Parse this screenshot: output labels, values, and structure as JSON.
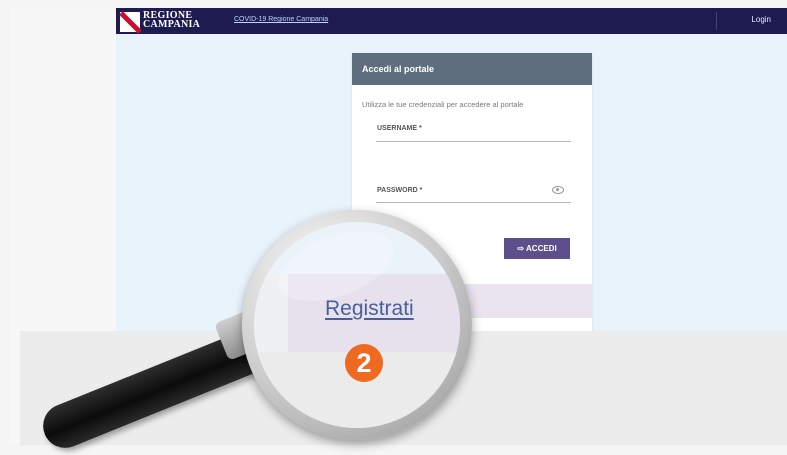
{
  "header": {
    "brand_line1": "REGIONE",
    "brand_line2": "CAMPANIA",
    "covid_link": "COVID-19 Regione Campania",
    "login": "Login"
  },
  "login_card": {
    "title": "Accedi al portale",
    "description": "Utilizza le tue credenziali per accedere al portale",
    "username_label": "USERNAME *",
    "password_label": "PASSWORD *",
    "submit_label": "ACCEDI"
  },
  "magnifier": {
    "register_link": "Registrati",
    "step_number": "2"
  },
  "colors": {
    "topbar": "#1d1b4f",
    "card_header": "#5e6e7e",
    "button": "#5c4f8c",
    "badge": "#ee6a20"
  }
}
